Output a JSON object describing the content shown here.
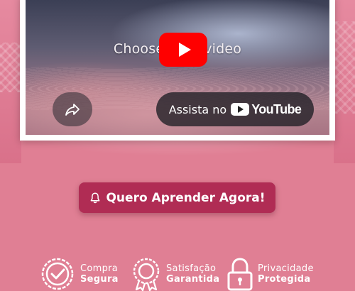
{
  "video": {
    "title": "Choose your video",
    "watch_label": "Assista no",
    "youtube_word": "YouTube"
  },
  "cta": {
    "label": "Quero Aprender Agora!"
  },
  "badges": [
    {
      "line1": "Compra",
      "line2": "Segura"
    },
    {
      "line1": "Satisfação",
      "line2": "Garantida"
    },
    {
      "line1": "Privacidade",
      "line2": "Protegida"
    }
  ],
  "colors": {
    "background": "#e07f94",
    "cta": "#b02c54",
    "play_red": "#ff0000"
  }
}
